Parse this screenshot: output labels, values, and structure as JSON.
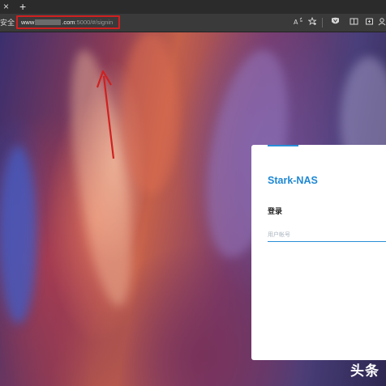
{
  "browser": {
    "tab_close_glyph": "×",
    "new_tab_glyph": "+",
    "security_label": "安全",
    "url": {
      "prefix": "www",
      "domain_suffix": ".com",
      "path": ":5000/#/signin"
    },
    "toolbar_icons": [
      "read-aloud-icon",
      "favorites-star-icon",
      "split-screen-icon",
      "extension-shield-icon",
      "collections-icon",
      "profile-icon"
    ]
  },
  "annotation": {
    "highlight_color": "#d02020"
  },
  "login_card": {
    "brand": "Stark-NAS",
    "title": "登录",
    "username_placeholder": "用户帐号",
    "accent_color": "#1e88d4"
  },
  "watermark": "头条"
}
